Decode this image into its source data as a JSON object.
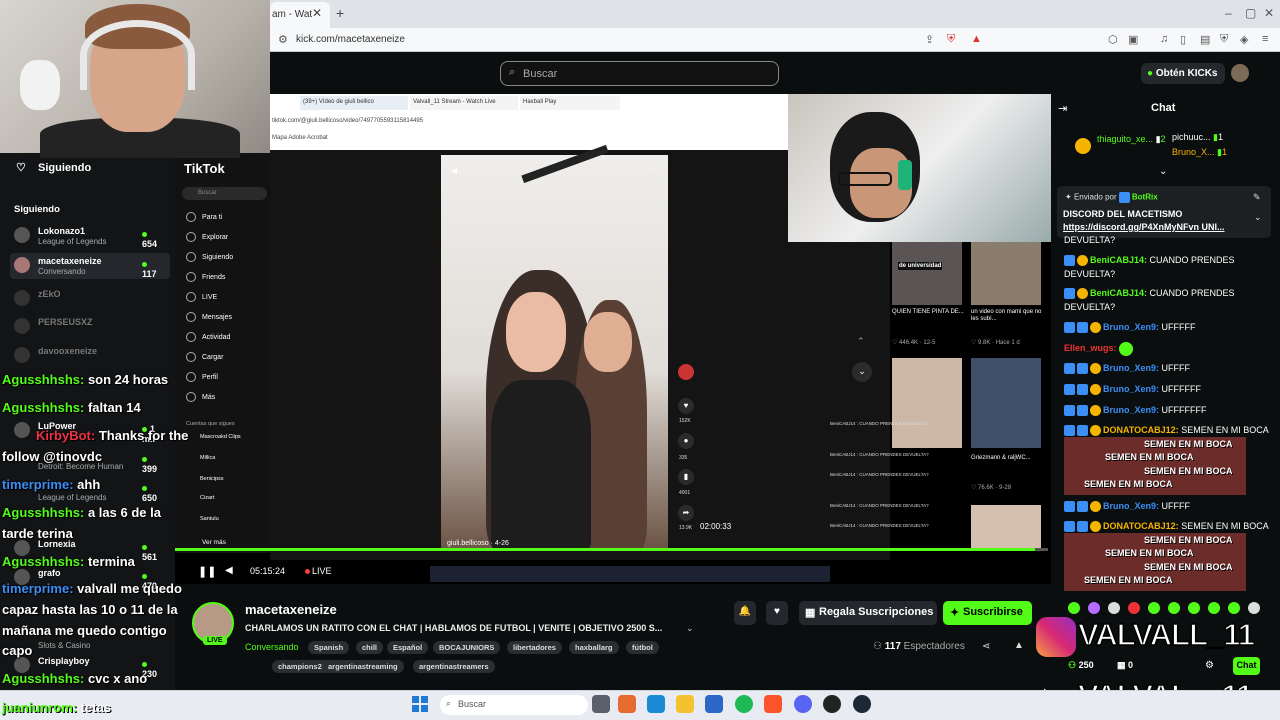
{
  "browser": {
    "tab_title": "am - Wat",
    "url": "kick.com/macetaxeneize"
  },
  "kick": {
    "search_placeholder": "Buscar",
    "get_kicks": "Obtén KICKs"
  },
  "sidebar": {
    "following_header": "Siguiendo",
    "following_label": "Siguiendo",
    "channels": [
      {
        "name": "Lokonazo1",
        "sub": "League of Legends",
        "viewers": "654"
      },
      {
        "name": "macetaxeneize",
        "sub": "Conversando",
        "viewers": "117"
      },
      {
        "name": "zEkO"
      },
      {
        "name": "PERSEUSXZ"
      },
      {
        "name": "davooxeneize"
      },
      {
        "name": "LuPower",
        "viewers": "1 mil"
      },
      {
        "name": "Detroit: Become Human",
        "viewers": "399"
      },
      {
        "name": "League of Legends",
        "viewers": "650"
      },
      {
        "name": "Lornexia",
        "viewers": "561"
      },
      {
        "name": "grafo",
        "viewers": "470"
      },
      {
        "name": "Slots & Casino",
        "viewers": ""
      },
      {
        "name": "Crisplayboy",
        "viewers": "230"
      }
    ]
  },
  "overlay_chat": [
    {
      "user": "Agusshhshs:",
      "msg": " son 24 horas"
    },
    {
      "user": "Agusshhshs:",
      "msg": " faltan 14"
    },
    {
      "user": "KirbyBot:",
      "msg": " Thanks for the"
    },
    {
      "user": "",
      "msg": "follow @tinovdc"
    },
    {
      "user": "timerprime:",
      "msg": " ahh"
    },
    {
      "user": "Agusshhshs:",
      "msg": " a las 6 de la"
    },
    {
      "user": "",
      "msg": "tarde terina"
    },
    {
      "user": "Agusshhshs:",
      "msg": " termina"
    },
    {
      "user": "timerprime:",
      "msg": " valvall me quedo"
    },
    {
      "user": "",
      "msg": "capaz hasta las 10 o 11 de la"
    },
    {
      "user": "",
      "msg": "mañana me quedo contigo"
    },
    {
      "user": "",
      "msg": "capo"
    },
    {
      "user": "Agusshhshs:",
      "msg": " cvc x ano"
    }
  ],
  "bottom_overlay": {
    "user": "juaniunrom:",
    "msg": " tetas"
  },
  "tiktok": {
    "logo": "TikTok",
    "search": "Buscar",
    "menu": [
      "Para ti",
      "Explorar",
      "Siguiendo",
      "Friends",
      "LIVE",
      "Mensajes",
      "Actividad",
      "Cargar",
      "Perfil",
      "Más"
    ],
    "accounts_label": "Cuentas que sigues",
    "accounts": [
      "Mascroakd Clips",
      "Millica",
      "Benicipss",
      "Cizart",
      "Santulu"
    ],
    "see_more": "Ver más",
    "video_caption": "giuli.bellicoso · 4-26",
    "likes": "152K",
    "comments": "335",
    "saves": "4001",
    "shares": "13.9K",
    "inner_time": "02:00:33",
    "thumbs": [
      {
        "title": "QUIEN TIENE PINTA DE...",
        "meta": "♡ 446.4K · 12-5"
      },
      {
        "title": "un video con mami que no les subí...",
        "meta": "♡ 9.8K · Hace 1 d"
      },
      {
        "title": "",
        "meta": ""
      },
      {
        "title": "Griezmann & raljWC...",
        "meta": "♡ 76.6K · 9-28"
      }
    ],
    "thumb_label": "de universidad"
  },
  "inner_browser": {
    "tabs": [
      "(39+) Vídeo de giuli bellico",
      "Valvall_11 Stream - Watch Live",
      "Haxball Play"
    ],
    "url": "tiktok.com/@giuli.bellicoso/video/7497705593115814495",
    "bookmarks": "Mapa   Adobe Acrobat"
  },
  "player": {
    "time": "05:15:24",
    "live": "LIVE"
  },
  "stream": {
    "name": "macetaxeneize",
    "title": "CHARLAMOS UN RATITO CON EL CHAT | HABLAMOS DE FUTBOL | VENITE | OBJETIVO 2500 S...",
    "category": "Conversando",
    "tags": [
      "Spanish",
      "chill",
      "Español",
      "BOCAJUNIORS",
      "libertadores",
      "haxballarg",
      "fútbol",
      "champions2025",
      "argentinastreaming",
      "argentinastreamers"
    ],
    "viewers_count": "117",
    "viewers_label": "Espectadores",
    "live_badge": "LIVE",
    "gift_label": "Regala Suscripciones",
    "subscribe_label": "Suscribirse"
  },
  "chat": {
    "title": "Chat",
    "gifters": [
      {
        "name": "thiaguito_xe...",
        "count": "2"
      },
      {
        "name": "pichuuc...",
        "count": "1"
      },
      {
        "name": "Bruno_X...",
        "count": "1"
      }
    ],
    "pinned_by": "Enviado por",
    "pinned_user": "BotRix",
    "pinned_msg": "DISCORD DEL MACETISMO",
    "pinned_link": "https://discord.gg/P4XnMyNFvn UNI...",
    "messages": [
      {
        "user": "",
        "text": "DEVUELTA?"
      },
      {
        "user": "BeniCABJ14:",
        "text": " CUANDO PRENDES DEVUELTA?"
      },
      {
        "user": "BeniCABJ14:",
        "text": " CUANDO PRENDES DEVUELTA?"
      },
      {
        "user": "Bruno_Xen9:",
        "text": " UFFFFF"
      },
      {
        "user": "Ellen_wugs:",
        "text": ""
      },
      {
        "user": "Bruno_Xen9:",
        "text": " UFFFF"
      },
      {
        "user": "Bruno_Xen9:",
        "text": " UFFFFFF"
      },
      {
        "user": "Bruno_Xen9:",
        "text": " UFFFFFFF"
      },
      {
        "user": "DONATOCABJ12:",
        "text": " SEMEN EN MI BOCA"
      },
      {
        "user": "Bruno_Xen9:",
        "text": " UFFFF"
      },
      {
        "user": "DONATOCABJ12:",
        "text": " SEMEN EN MI BOCA"
      }
    ],
    "spam": "SEMEN EN MI BOCA",
    "points": "250",
    "zero": "0",
    "chat_button": "Chat"
  },
  "overlay_brand": {
    "ig": "VALVALL_11",
    "tt": "VALVAL__11"
  },
  "taskbar": {
    "search": "Buscar"
  }
}
